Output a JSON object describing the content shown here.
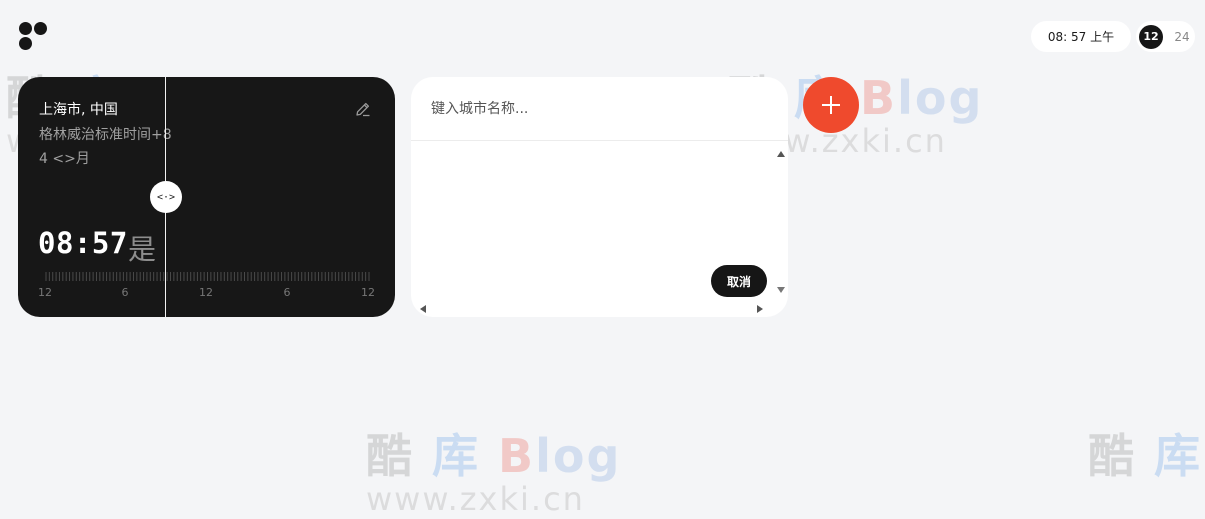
{
  "header": {
    "current_time": "08: 57 上午",
    "format_options": [
      "12",
      "24"
    ],
    "active_format": "12"
  },
  "city_card": {
    "name": "上海市, 中国",
    "timezone": "格林威治标准时间+8",
    "date": "4 <>月",
    "time": "08:57",
    "period": "是",
    "handle_glyph": "<·>",
    "tick_labels": [
      "12",
      "6",
      "12",
      "6",
      "12"
    ]
  },
  "search_card": {
    "placeholder": "键入城市名称...",
    "cancel_label": "取消"
  },
  "watermark": {
    "ku": "酷",
    "ku2": "库",
    "blog_b": "B",
    "blog_rest": "log",
    "url": "www.zxki.cn"
  },
  "colors": {
    "accent": "#ef4a2d",
    "dark_card": "#171717",
    "background": "#f4f5f7"
  },
  "icons": {
    "logo": "dots-logo-icon",
    "edit": "pencil-icon",
    "add": "plus-icon",
    "scrub": "drag-handle-icon"
  }
}
